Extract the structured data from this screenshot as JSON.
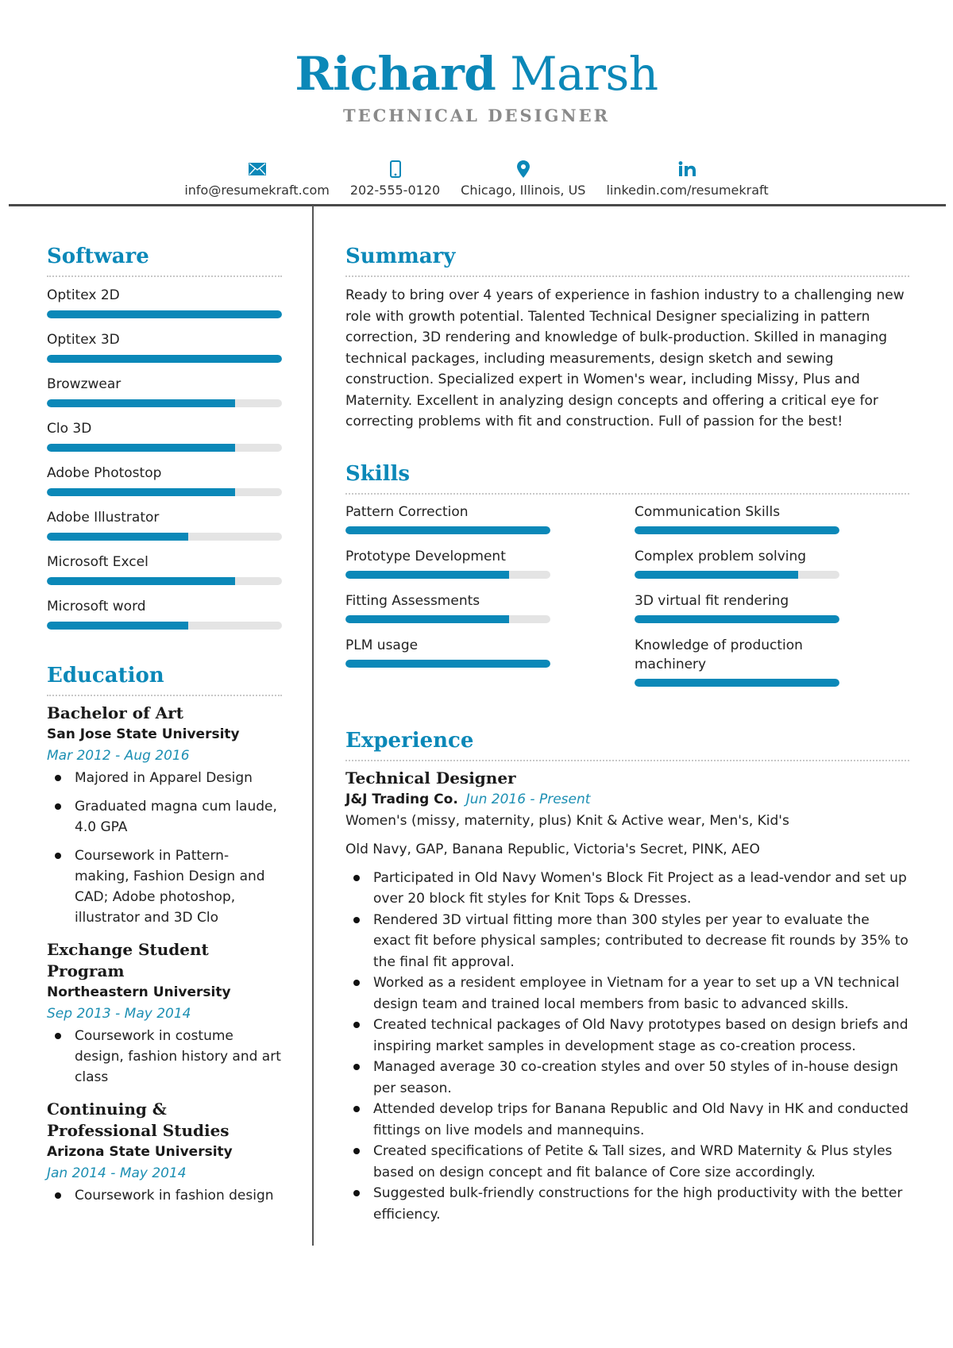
{
  "header": {
    "first_name": "Richard",
    "last_name": "Marsh",
    "job_title": "TECHNICAL DESIGNER",
    "accent_color": "#0b88b8",
    "contacts": [
      {
        "icon": "envelope-icon",
        "text": "info@resumekraft.com"
      },
      {
        "icon": "phone-icon",
        "text": "202-555-0120"
      },
      {
        "icon": "location-pin-icon",
        "text": "Chicago, Illinois, US"
      },
      {
        "icon": "linkedin-icon",
        "text": "linkedin.com/resumekraft"
      }
    ]
  },
  "software": {
    "title": "Software",
    "items": [
      {
        "label": "Optitex 2D",
        "level": 1.0
      },
      {
        "label": "Optitex 3D",
        "level": 1.0
      },
      {
        "label": "Browzwear",
        "level": 0.8
      },
      {
        "label": "Clo 3D",
        "level": 0.8
      },
      {
        "label": "Adobe Photostop",
        "level": 0.8
      },
      {
        "label": "Adobe Illustrator",
        "level": 0.6
      },
      {
        "label": "Microsoft Excel",
        "level": 0.8
      },
      {
        "label": "Microsoft word",
        "level": 0.6
      }
    ]
  },
  "education": {
    "title": "Education",
    "items": [
      {
        "degree": "Bachelor of Art",
        "school": "San Jose State University",
        "dates": "Mar 2012 - Aug 2016",
        "bullets": [
          "Majored in Apparel Design",
          "Graduated magna cum laude, 4.0 GPA",
          "Coursework in Pattern-making, Fashion Design and CAD; Adobe photoshop, illustrator and 3D Clo"
        ]
      },
      {
        "degree": "Exchange Student Program",
        "school": "Northeastern University",
        "dates": "Sep 2013 - May 2014",
        "bullets": [
          "Coursework in costume design, fashion history and art class"
        ]
      },
      {
        "degree": "Continuing & Professional Studies",
        "school": "Arizona State University",
        "dates": "Jan 2014 - May 2014",
        "bullets": [
          "Coursework in fashion design"
        ]
      }
    ]
  },
  "summary": {
    "title": "Summary",
    "text": "Ready to bring over 4 years of experience in fashion industry to a challenging new role with growth potential. Talented Technical Designer specializing in pattern correction, 3D rendering and knowledge of bulk-production. Skilled in managing technical packages, including measurements, design sketch and sewing construction. Specialized expert in Women's wear, including Missy, Plus and Maternity. Excellent in analyzing design concepts and offering a critical eye for correcting problems with fit and construction. Full of passion for the best!"
  },
  "skills": {
    "title": "Skills",
    "items": [
      {
        "label": "Pattern Correction",
        "level": 1.0
      },
      {
        "label": "Communication Skills",
        "level": 1.0
      },
      {
        "label": "Prototype Development",
        "level": 0.8
      },
      {
        "label": "Complex problem solving",
        "level": 0.8
      },
      {
        "label": "Fitting Assessments",
        "level": 0.8
      },
      {
        "label": "3D virtual fit rendering",
        "level": 1.0
      },
      {
        "label": "PLM usage",
        "level": 1.0
      },
      {
        "label": "Knowledge of production machinery",
        "level": 1.0
      }
    ]
  },
  "experience": {
    "title": "Experience",
    "items": [
      {
        "role": "Technical Designer",
        "company": "J&J Trading Co.",
        "dates": "Jun 2016 - Present",
        "lines": [
          "Women's (missy, maternity, plus) Knit & Active wear, Men's, Kid's",
          "Old Navy, GAP, Banana Republic, Victoria's Secret, PINK, AEO"
        ],
        "bullets": [
          "Participated in Old Navy Women's Block Fit Project as a lead-vendor and set up over 20 block fit styles for Knit Tops & Dresses.",
          "Rendered 3D virtual fitting more than 300 styles per year to evaluate the exact fit before physical samples; contributed to decrease fit rounds by 35% to the final fit approval.",
          "Worked as a resident employee in Vietnam for a year to set up a VN technical design team and trained local members from basic to advanced skills.",
          "Created technical packages of Old Navy prototypes based on design briefs and inspiring market samples in development stage as co-creation process.",
          "Managed average 30 co-creation styles and over 50 styles of in-house design per season.",
          "Attended develop trips for Banana Republic and Old Navy in HK and conducted fittings on live models and mannequins.",
          "Created specifications of Petite & Tall sizes, and WRD Maternity & Plus styles based on design concept and fit balance of Core size accordingly.",
          "Suggested bulk-friendly constructions for the high productivity with the better efficiency."
        ]
      }
    ]
  }
}
